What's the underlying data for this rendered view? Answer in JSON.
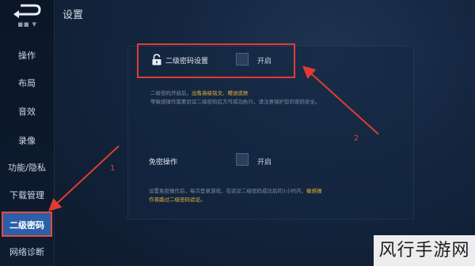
{
  "sidebar": {
    "items": [
      {
        "label": "操作"
      },
      {
        "label": "布局"
      },
      {
        "label": "音效"
      },
      {
        "label": "录像"
      },
      {
        "label": "功能/隐私"
      },
      {
        "label": "下载管理"
      },
      {
        "label": "二级密码"
      },
      {
        "label": "网络诊断"
      }
    ]
  },
  "header": {
    "title": "设置"
  },
  "password_setting": {
    "label": "二级密码设置",
    "toggle_label": "开启",
    "desc_line1_prefix": "二级密码开启后，",
    "desc_line1_highlight": "出售高级铭文、赠送皮肤",
    "desc_line2": "等敏感操作需要验证二级密码后方可成功执行，请注意保护您的密码安全。"
  },
  "exempt_setting": {
    "label": "免密操作",
    "toggle_label": "开启",
    "desc_line1_prefix": "设置免密操作后，每次登录游戏，在验证二级密码成功后的1小时内，",
    "desc_line1_highlight": "敏感操",
    "desc_line2_highlight": "作将跳过二级密码验证。"
  },
  "annotations": {
    "one": "1",
    "two": "2"
  },
  "watermark": "风行手游网",
  "colors": {
    "accent": "#2b5fa9",
    "highlight_red": "#e23b31",
    "warning_text": "#e7b43c"
  }
}
